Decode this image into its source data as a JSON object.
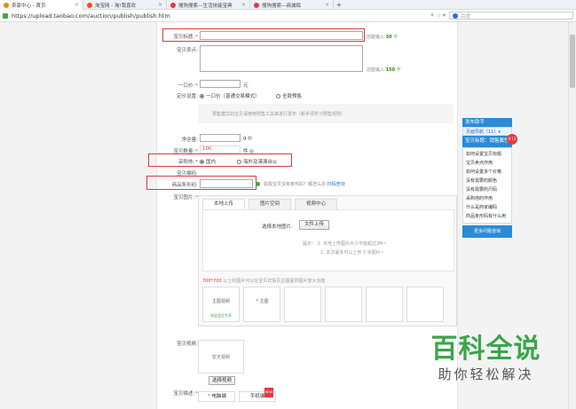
{
  "browser": {
    "tabs": [
      {
        "label": "卖家中心 - 首页",
        "color": "#f08a00"
      },
      {
        "label": "淘宝网 - 淘!我喜欢",
        "color": "#ff5000"
      },
      {
        "label": "搜狗搜索—生活技能宝典",
        "color": "#e4393c"
      },
      {
        "label": "搜狗搜索—商城辉",
        "color": "#e4393c"
      }
    ],
    "new_tab": "+",
    "url": "https://upload.taobao.com/auction/publish/publish.htm",
    "addr_icons": "⚘ ☆ ▾",
    "search_placeholder": "百度"
  },
  "form": {
    "title_label": "宝贝标题:",
    "title_hint_prefix": "还能输入",
    "title_hint_count": "30",
    "title_hint_suffix": "字",
    "selling_label": "宝贝卖点:",
    "selling_hint_prefix": "还能输入",
    "selling_hint_count": "150",
    "selling_hint_suffix": "字",
    "price_label": "一口价:",
    "price_unit": "元",
    "pricing_label": "定价设置:",
    "pricing_option_1": "一口价（普通交易模式）",
    "pricing_option_2": "全款预售",
    "pricing_tip": "预售模式的宝贝请使用预售工具来进行发布（新手须学习预售规则）",
    "net_label": "净含量:",
    "net_unit": "g",
    "qty_label": "宝贝数量:",
    "qty_value": "100",
    "qty_unit": "件",
    "origin_label": "采购地:",
    "origin_option_1": "国内",
    "origin_option_2": "海外及港澳台",
    "code_label": "宝贝编码:",
    "barcode_label": "商品条形码:",
    "barcode_hint": "如需宝贝没有条形码？都怎么办",
    "barcode_link": "扫码查询",
    "image_label": "宝贝图片:",
    "upload_tabs": [
      "本地上传",
      "图片空间",
      "视频中心"
    ],
    "upload_select_label": "选择本地图片:",
    "upload_button": "文件上传",
    "upload_tip_1": "提示：  1. 本地上传图片大小不能超过3M~",
    "upload_tip_2": "2. 本次最多可以上传 5 张图片~",
    "thumbs_note_prefix": "700*700",
    "thumbs_note": "以上的图片可以在宝贝详情页主图提供图片放大功能",
    "thumb_1": "主图视频",
    "thumb_1_sub": "淘宝会员专享",
    "thumb_2": "主图",
    "video_label": "宝贝视频:",
    "video_box": "暂无视频",
    "video_button": "选择视频",
    "desc_label": "宝贝描述:",
    "desc_tabs": [
      "电脑端",
      "手机端"
    ],
    "desc_badge": "NEW"
  },
  "help": {
    "title": "发布助手",
    "sub": "页面导航（11）▾",
    "selected": "宝贝标题：销售属性",
    "dot": "0.13",
    "items": [
      "如何设置宝贝标题",
      "宝贝卖点作用",
      "如何设置多个价格",
      "没有需要的颜色",
      "没有需要的尺码",
      "采购地的作用",
      "什么是商家编码",
      "商品条形码有什么用"
    ],
    "more": "更多问题咨询"
  },
  "watermark": {
    "main": "百科全说",
    "sub": "助你轻松解决"
  }
}
